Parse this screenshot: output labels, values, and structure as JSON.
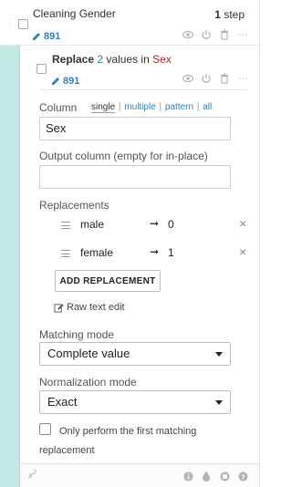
{
  "outer_step": {
    "title": "Cleaning Gender",
    "step_count_number": "1",
    "step_count_label": "step",
    "rows_badge": "891"
  },
  "inner_step": {
    "title_prefix": "Replace",
    "title_count": "2",
    "title_middle": "values in",
    "title_column": "Sex",
    "rows_badge": "891"
  },
  "form": {
    "column_label": "Column",
    "column_modes": [
      "single",
      "multiple",
      "pattern",
      "all"
    ],
    "column_value": "Sex",
    "output_label": "Output column (empty for in-place)",
    "output_value": "",
    "replacements_label": "Replacements",
    "replacements": [
      {
        "from": "male",
        "to": "0"
      },
      {
        "from": "female",
        "to": "1"
      }
    ],
    "add_replacement_label": "ADD REPLACEMENT",
    "raw_text_edit_label": "Raw text edit",
    "matching_mode_label": "Matching mode",
    "matching_mode_value": "Complete value",
    "normalization_mode_label": "Normalization mode",
    "normalization_mode_value": "Exact",
    "only_first_label": "Only perform the first matching replacement",
    "only_first_checked": false
  },
  "footer": {
    "formula_glyph": "x",
    "formula_sup": "2"
  },
  "colors": {
    "accent_blue": "#2b7fc2",
    "column_red": "#b0202a",
    "teal_bar": "#bfe9e2"
  }
}
